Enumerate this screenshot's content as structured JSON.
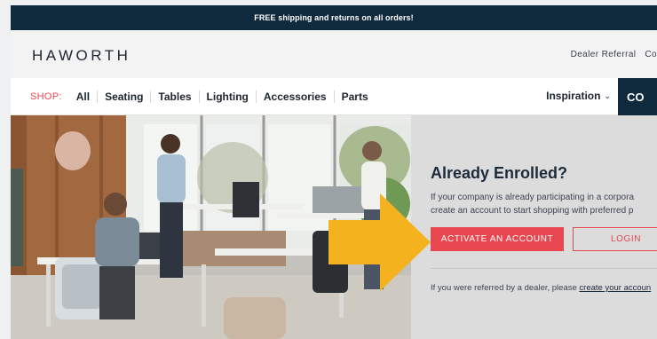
{
  "promo": {
    "text": "FREE shipping and returns on all orders!"
  },
  "header": {
    "logo": "HAWORTH",
    "links": [
      "Dealer Referral",
      "Co"
    ]
  },
  "nav": {
    "shop_label": "SHOP:",
    "items": [
      "All",
      "Seating",
      "Tables",
      "Lighting",
      "Accessories",
      "Parts"
    ],
    "inspiration": "Inspiration",
    "cta": "CO"
  },
  "panel": {
    "title": "Already Enrolled?",
    "line1": "If your company is already participating in a corpora",
    "line2": "create an account to start shopping with preferred p",
    "activate_label": "ACTIVATE AN ACCOUNT",
    "login_label": "LOGIN",
    "referral_prefix": "If you were referred by a dealer, please ",
    "referral_link": "create your accoun"
  },
  "colors": {
    "brand_dark": "#0f2a3d",
    "accent_red": "#e8474f",
    "arrow_yellow": "#f5b21f"
  }
}
